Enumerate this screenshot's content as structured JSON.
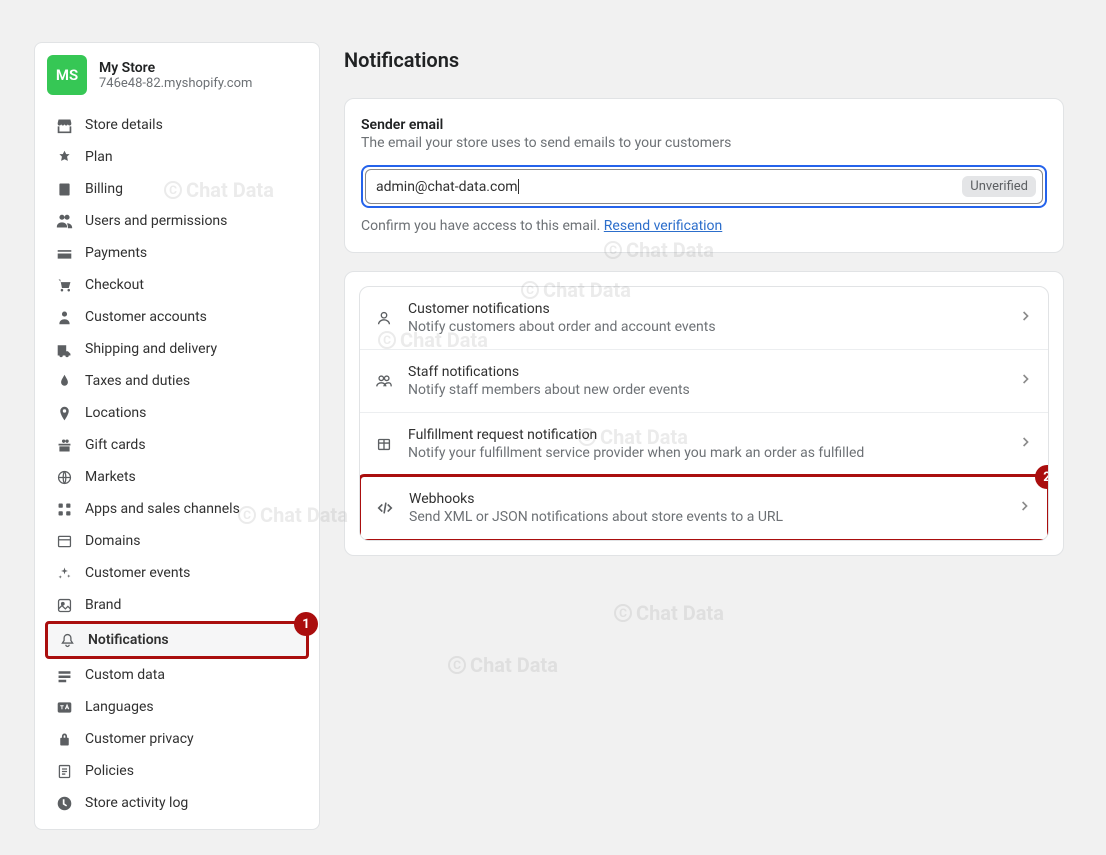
{
  "store": {
    "badge": "MS",
    "name": "My Store",
    "domain": "746e48-82.myshopify.com"
  },
  "sidebar": {
    "items": [
      {
        "label": "Store details",
        "icon": "store"
      },
      {
        "label": "Plan",
        "icon": "plan"
      },
      {
        "label": "Billing",
        "icon": "billing"
      },
      {
        "label": "Users and permissions",
        "icon": "users"
      },
      {
        "label": "Payments",
        "icon": "payments"
      },
      {
        "label": "Checkout",
        "icon": "checkout"
      },
      {
        "label": "Customer accounts",
        "icon": "customer"
      },
      {
        "label": "Shipping and delivery",
        "icon": "shipping"
      },
      {
        "label": "Taxes and duties",
        "icon": "taxes"
      },
      {
        "label": "Locations",
        "icon": "locations"
      },
      {
        "label": "Gift cards",
        "icon": "gift"
      },
      {
        "label": "Markets",
        "icon": "markets"
      },
      {
        "label": "Apps and sales channels",
        "icon": "apps"
      },
      {
        "label": "Domains",
        "icon": "domains"
      },
      {
        "label": "Customer events",
        "icon": "events"
      },
      {
        "label": "Brand",
        "icon": "brand"
      },
      {
        "label": "Notifications",
        "icon": "notifications",
        "active": true,
        "callout": "1"
      },
      {
        "label": "Custom data",
        "icon": "custom"
      },
      {
        "label": "Languages",
        "icon": "languages"
      },
      {
        "label": "Customer privacy",
        "icon": "privacy"
      },
      {
        "label": "Policies",
        "icon": "policies"
      },
      {
        "label": "Store activity log",
        "icon": "activity"
      }
    ]
  },
  "page": {
    "title": "Notifications"
  },
  "sender": {
    "header": "Sender email",
    "desc": "The email your store uses to send emails to your customers",
    "value": "admin@chat-data.com",
    "badge": "Unverified",
    "confirm_prefix": "Confirm you have access to this email. ",
    "resend": "Resend verification"
  },
  "rows": [
    {
      "title": "Customer notifications",
      "desc": "Notify customers about order and account events",
      "icon": "person"
    },
    {
      "title": "Staff notifications",
      "desc": "Notify staff members about new order events",
      "icon": "group"
    },
    {
      "title": "Fulfillment request notification",
      "desc": "Notify your fulfillment service provider when you mark an order as fulfilled",
      "icon": "package"
    },
    {
      "title": "Webhooks",
      "desc": "Send XML or JSON notifications about store events to a URL",
      "icon": "code",
      "callout": "2"
    }
  ],
  "watermark": "Chat Data"
}
